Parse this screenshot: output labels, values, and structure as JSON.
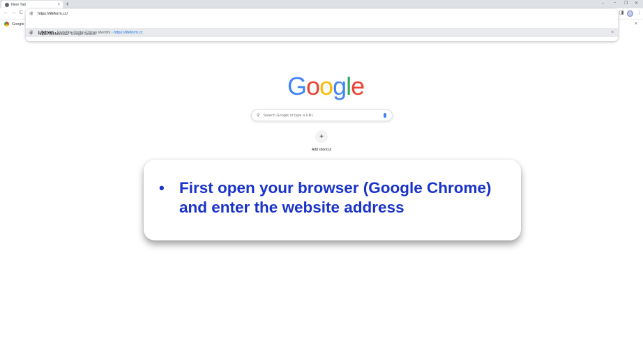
{
  "browser": {
    "tab_title": "New Tab",
    "tab_close": "×",
    "new_tab": "+",
    "window_controls": [
      "⌄",
      "–",
      "❐",
      "✕"
    ]
  },
  "toolbar": {
    "back": "←",
    "forward": "→",
    "reload": "C",
    "side_panel": "◨",
    "menu": "⋮"
  },
  "omnibox": {
    "value": "https://lifeform.cc/",
    "suggestions": [
      {
        "title": "Lifeform",
        "separator": " - Redefine Digital Citizen Identify - ",
        "url": "https://lifeform.cc",
        "remove": "×"
      },
      {
        "title": "https://lifeform.cc/",
        "separator": " - Google Search"
      }
    ]
  },
  "bookmarks": {
    "item": "Google",
    "close": "×"
  },
  "ntp": {
    "logo_letters": [
      "G",
      "o",
      "o",
      "g",
      "l",
      "e"
    ],
    "search_placeholder": "Search Google or type a URL",
    "add_shortcut_symbol": "+",
    "add_shortcut_label": "Add shortcut"
  },
  "callout": {
    "bullet": "•",
    "text": "First open your browser (Google Chrome) and enter the website address"
  },
  "colors": {
    "google_blue": "#4285f4",
    "google_red": "#ea4335",
    "google_yellow": "#fbbc05",
    "google_green": "#34a853",
    "callout_text": "#1a33c9"
  }
}
